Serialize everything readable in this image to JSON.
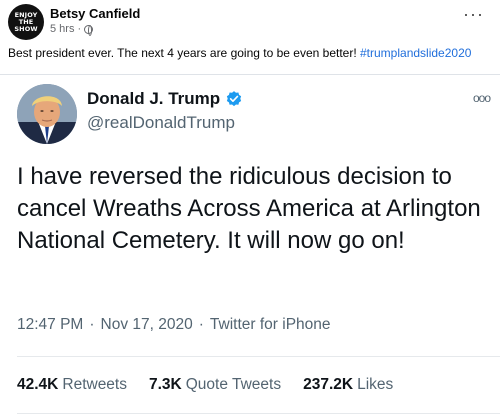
{
  "fb_post": {
    "avatar_text": [
      "ENJOY",
      "THE",
      "SHOW"
    ],
    "author": "Betsy Canfield",
    "time": "5 hrs",
    "separator": "·",
    "privacy_icon": "globe-icon",
    "more_icon": "more-horizontal-icon",
    "more_label": "···",
    "text": "Best president ever. The next 4 years are going to be even better! ",
    "hashtag": "#trumplandslide2020",
    "hashtag_color": "#216fdb"
  },
  "tweet": {
    "display_name": "Donald J. Trump",
    "handle": "@realDonaldTrump",
    "verified_icon": "verified-badge-icon",
    "verified_color": "#1d9bf0",
    "more_label": "ooo",
    "body": "I have reversed the ridiculous decision to cancel Wreaths Across America at Arlington National Cemetery. It will now go on!",
    "time": "12:47 PM",
    "date": "Nov 17, 2020",
    "dot": "·",
    "source": "Twitter for iPhone",
    "stats": [
      {
        "count": "42.4K",
        "label": "Retweets"
      },
      {
        "count": "7.3K",
        "label": "Quote Tweets"
      },
      {
        "count": "237.2K",
        "label": "Likes"
      }
    ]
  }
}
